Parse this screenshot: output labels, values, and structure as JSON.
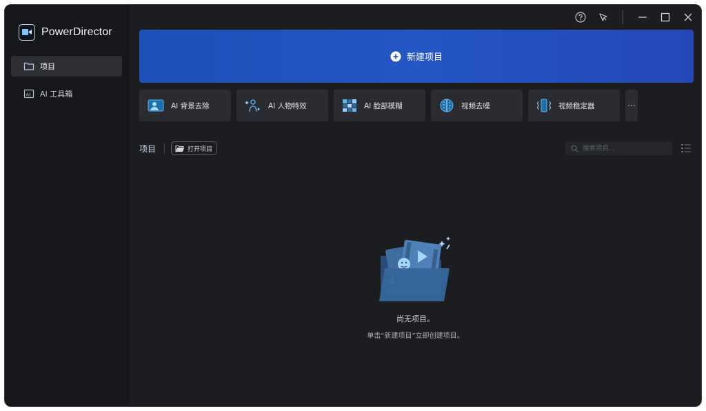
{
  "app": {
    "name": "PowerDirector"
  },
  "sidebar": {
    "items": [
      {
        "label": "项目",
        "icon": "folder-icon",
        "active": true
      },
      {
        "label": "AI 工具箱",
        "icon": "ai-toolbox-icon",
        "active": false
      }
    ]
  },
  "titlebar": {
    "icons": [
      "help-icon",
      "notification-icon",
      "minimize-icon",
      "maximize-icon",
      "close-icon"
    ]
  },
  "main": {
    "new_project_label": "新建项目",
    "tools": [
      {
        "label": "AI 背景去除",
        "icon": "background-removal-icon"
      },
      {
        "label": "AI 人物特效",
        "icon": "body-effect-icon"
      },
      {
        "label": "AI 脸部模糊",
        "icon": "face-blur-icon"
      },
      {
        "label": "视频去噪",
        "icon": "denoise-icon"
      },
      {
        "label": "视频稳定器",
        "icon": "stabilizer-icon"
      }
    ],
    "more_label": "···",
    "projects_title": "项目",
    "open_project_label": "打开项目",
    "search_placeholder": "搜索项目...",
    "empty_title": "尚无项目。",
    "empty_subtitle": "单击“新建项目”立即创建项目。"
  },
  "colors": {
    "accent_blue": "#2456c4",
    "sidebar_bg": "#16171a",
    "main_bg": "#1c1d21",
    "tile_bg": "#2a2c31"
  }
}
